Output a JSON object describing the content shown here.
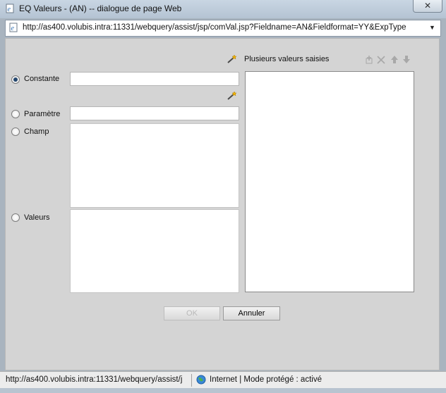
{
  "window": {
    "title": "EQ Valeurs - (AN) -- dialogue de page Web",
    "close_glyph": "✕"
  },
  "address_bar": {
    "url": "http://as400.volubis.intra:11331/webquery/assist/jsp/comVal.jsp?Fieldname=AN&Fieldformat=YY&ExpType",
    "dropdown_glyph": "▼"
  },
  "form": {
    "constante_label": "Constante",
    "constante_value": "",
    "parametre_label": "Paramètre",
    "parametre_value": "",
    "champ_label": "Champ",
    "valeurs_label": "Valeurs",
    "selected": "constante"
  },
  "multi_values": {
    "label": "Plusieurs valeurs saisies"
  },
  "buttons": {
    "ok": "OK",
    "cancel": "Annuler"
  },
  "status_bar": {
    "url": "http://as400.volubis.intra:11331/webquery/assist/j",
    "zone": "Internet | Mode protégé : activé"
  },
  "icons": {
    "page": "ie-page-icon",
    "wand": "magic-wand-icon",
    "add": "add-icon",
    "delete": "delete-icon",
    "up": "arrow-up-icon",
    "down": "arrow-down-icon",
    "globe": "globe-icon"
  }
}
